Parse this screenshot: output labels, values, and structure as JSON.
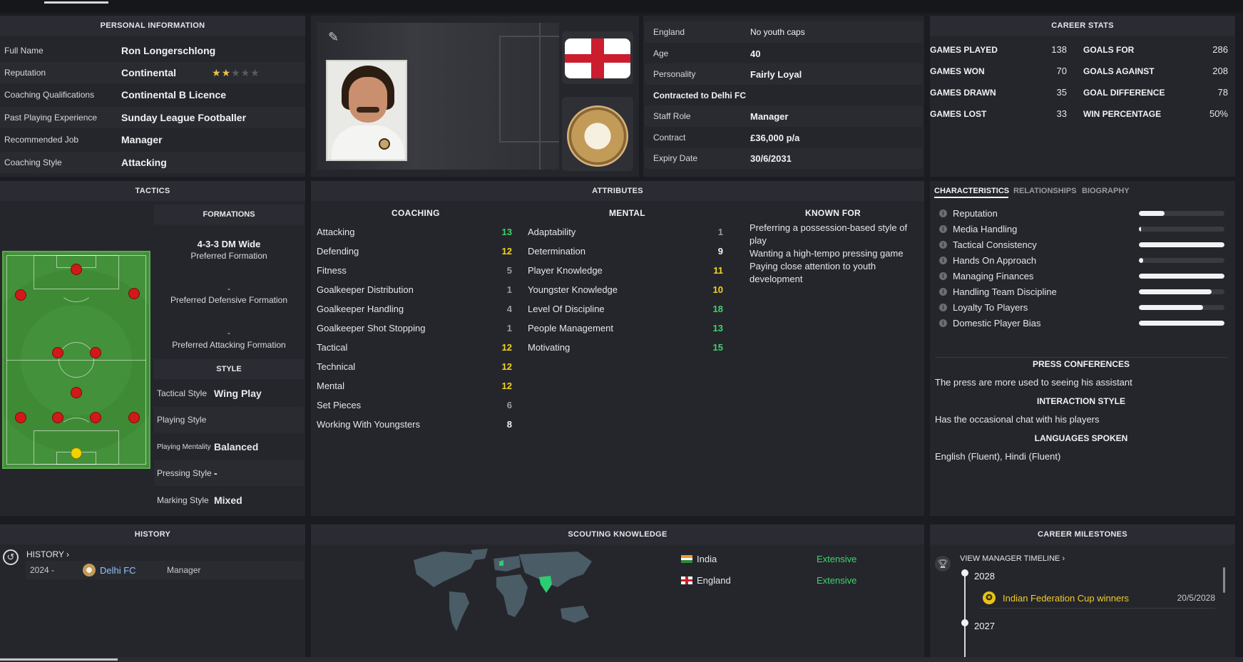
{
  "personal": {
    "title": "PERSONAL INFORMATION",
    "rows": [
      {
        "label": "Full Name",
        "value": "Ron Longerschlong"
      },
      {
        "label": "Reputation",
        "value": "Continental"
      },
      {
        "label": "Coaching Qualifications",
        "value": "Continental B Licence"
      },
      {
        "label": "Past Playing Experience",
        "value": "Sunday League Footballer"
      },
      {
        "label": "Recommended Job",
        "value": "Manager"
      },
      {
        "label": "Coaching Style",
        "value": "Attacking"
      }
    ],
    "reputation_stars": 2,
    "reputation_stars_max": 5
  },
  "nation": {
    "flag": "england-flag",
    "club_badge": "sudeva-delhi-fc-badge"
  },
  "contract": {
    "rows": [
      {
        "label": "England",
        "value": "No youth caps"
      },
      {
        "label": "Age",
        "value": "40"
      },
      {
        "label": "Personality",
        "value": "Fairly Loyal"
      },
      {
        "label": "Contracted to Delhi FC",
        "value": ""
      },
      {
        "label": "Staff Role",
        "value": "Manager"
      },
      {
        "label": "Contract",
        "value": "£36,000 p/a"
      },
      {
        "label": "Expiry Date",
        "value": "30/6/2031"
      }
    ]
  },
  "career_stats": {
    "title": "CAREER STATS",
    "left": [
      {
        "label": "GAMES PLAYED",
        "value": "138"
      },
      {
        "label": "GAMES WON",
        "value": "70"
      },
      {
        "label": "GAMES DRAWN",
        "value": "35"
      },
      {
        "label": "GAMES LOST",
        "value": "33"
      }
    ],
    "right": [
      {
        "label": "GOALS FOR",
        "value": "286"
      },
      {
        "label": "GOALS AGAINST",
        "value": "208"
      },
      {
        "label": "GOAL DIFFERENCE",
        "value": "78"
      },
      {
        "label": "WIN PERCENTAGE",
        "value": "50%"
      }
    ]
  },
  "tactics": {
    "title": "TACTICS",
    "formations_title": "FORMATIONS",
    "preferred_formation": "4-3-3 DM Wide",
    "preferred_formation_label": "Preferred Formation",
    "defensive_formation": "-",
    "defensive_formation_label": "Preferred Defensive Formation",
    "attacking_formation": "-",
    "attacking_formation_label": "Preferred Attacking Formation",
    "style_title": "STYLE",
    "style_rows": [
      {
        "label": "Tactical Style",
        "value": "Wing Play"
      },
      {
        "label": "Playing Style",
        "value": ""
      },
      {
        "label": "Playing Mentality",
        "value": "Balanced"
      },
      {
        "label": "Pressing Style",
        "value": "-"
      },
      {
        "label": "Marking Style",
        "value": "Mixed"
      }
    ]
  },
  "attributes": {
    "title": "ATTRIBUTES",
    "coaching_title": "COACHING",
    "coaching": [
      {
        "label": "Attacking",
        "value": "13",
        "color": "g"
      },
      {
        "label": "Defending",
        "value": "12",
        "color": "y"
      },
      {
        "label": "Fitness",
        "value": "5",
        "color": "gr"
      },
      {
        "label": "Goalkeeper Distribution",
        "value": "1",
        "color": "gr"
      },
      {
        "label": "Goalkeeper Handling",
        "value": "4",
        "color": "gr"
      },
      {
        "label": "Goalkeeper Shot Stopping",
        "value": "1",
        "color": "gr"
      },
      {
        "label": "Tactical",
        "value": "12",
        "color": "y"
      },
      {
        "label": "Technical",
        "value": "12",
        "color": "y"
      },
      {
        "label": "Mental",
        "value": "12",
        "color": "y"
      },
      {
        "label": "Set Pieces",
        "value": "6",
        "color": "gr"
      },
      {
        "label": "Working With Youngsters",
        "value": "8",
        "color": "w"
      }
    ],
    "mental_title": "MENTAL",
    "mental": [
      {
        "label": "Adaptability",
        "value": "1",
        "color": "gr"
      },
      {
        "label": "Determination",
        "value": "9",
        "color": "w"
      },
      {
        "label": "Player Knowledge",
        "value": "11",
        "color": "y"
      },
      {
        "label": "Youngster Knowledge",
        "value": "10",
        "color": "y"
      },
      {
        "label": "Level Of Discipline",
        "value": "18",
        "color": "g"
      },
      {
        "label": "People Management",
        "value": "13",
        "color": "g"
      },
      {
        "label": "Motivating",
        "value": "15",
        "color": "g"
      }
    ],
    "known_for_title": "KNOWN FOR",
    "known_for": [
      "Preferring a possession-based style of play",
      "Wanting a high-tempo pressing game",
      "Paying close attention to youth development"
    ]
  },
  "characteristics": {
    "tabs": [
      "CHARACTERISTICS",
      "RELATIONSHIPS",
      "BIOGRAPHY"
    ],
    "rows": [
      {
        "label": "Reputation",
        "level": 0.3
      },
      {
        "label": "Media Handling",
        "level": 0.02
      },
      {
        "label": "Tactical Consistency",
        "level": 1.0
      },
      {
        "label": "Hands On Approach",
        "level": 0.05
      },
      {
        "label": "Managing Finances",
        "level": 1.0
      },
      {
        "label": "Handling Team Discipline",
        "level": 0.85
      },
      {
        "label": "Loyalty To Players",
        "level": 0.75
      },
      {
        "label": "Domestic Player Bias",
        "level": 1.0
      }
    ],
    "press_title": "PRESS CONFERENCES",
    "press_text": "The press are more used to seeing his assistant",
    "interaction_title": "INTERACTION STYLE",
    "interaction_text": "Has the occasional chat with his players",
    "languages_title": "LANGUAGES SPOKEN",
    "languages_text": "English (Fluent), Hindi (Fluent)"
  },
  "history": {
    "title": "HISTORY",
    "link": "HISTORY",
    "rows": [
      {
        "years": "2024 -",
        "club": "Delhi FC",
        "role": "Manager"
      }
    ]
  },
  "scouting": {
    "title": "SCOUTING KNOWLEDGE",
    "rows": [
      {
        "country": "India",
        "level": "Extensive"
      },
      {
        "country": "England",
        "level": "Extensive"
      }
    ]
  },
  "milestones": {
    "title": "CAREER MILESTONES",
    "link": "VIEW MANAGER TIMELINE",
    "years": [
      {
        "year": "2028",
        "items": [
          {
            "text": "Indian Federation Cup winners",
            "date": "20/5/2028"
          }
        ]
      },
      {
        "year": "2027",
        "items": []
      }
    ]
  }
}
